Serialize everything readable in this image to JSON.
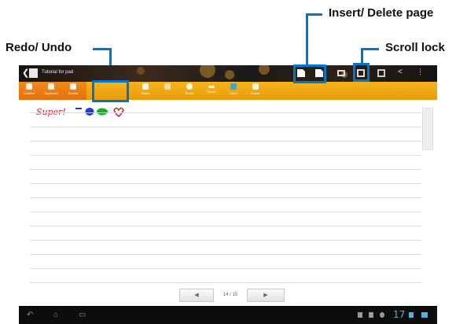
{
  "callouts": {
    "redo_undo": "Redo/ Undo",
    "insert_delete": "Insert/ Delete page",
    "scroll_lock": "Scroll lock"
  },
  "app": {
    "title": "Tutorial for pad",
    "toolbar_accent": "#f5b31c",
    "tool_group_color": "#e4700f",
    "highlight_color": "#0077c8"
  },
  "toolbar": {
    "tools": [
      "Content",
      "Keyboard",
      "Doodle",
      "Insert",
      "",
      "Brush",
      "Stroke",
      "Color",
      "Eraser"
    ]
  },
  "pager": {
    "prev_icon": "chevron-left",
    "page_text": "14 / 15",
    "next_icon": "chevron-right"
  },
  "statusbar": {
    "clock": "17"
  },
  "note": {
    "handwriting": "Super!",
    "shape_colors": [
      "#1e3fcf",
      "#1e8a2e",
      "#c2203a"
    ]
  }
}
